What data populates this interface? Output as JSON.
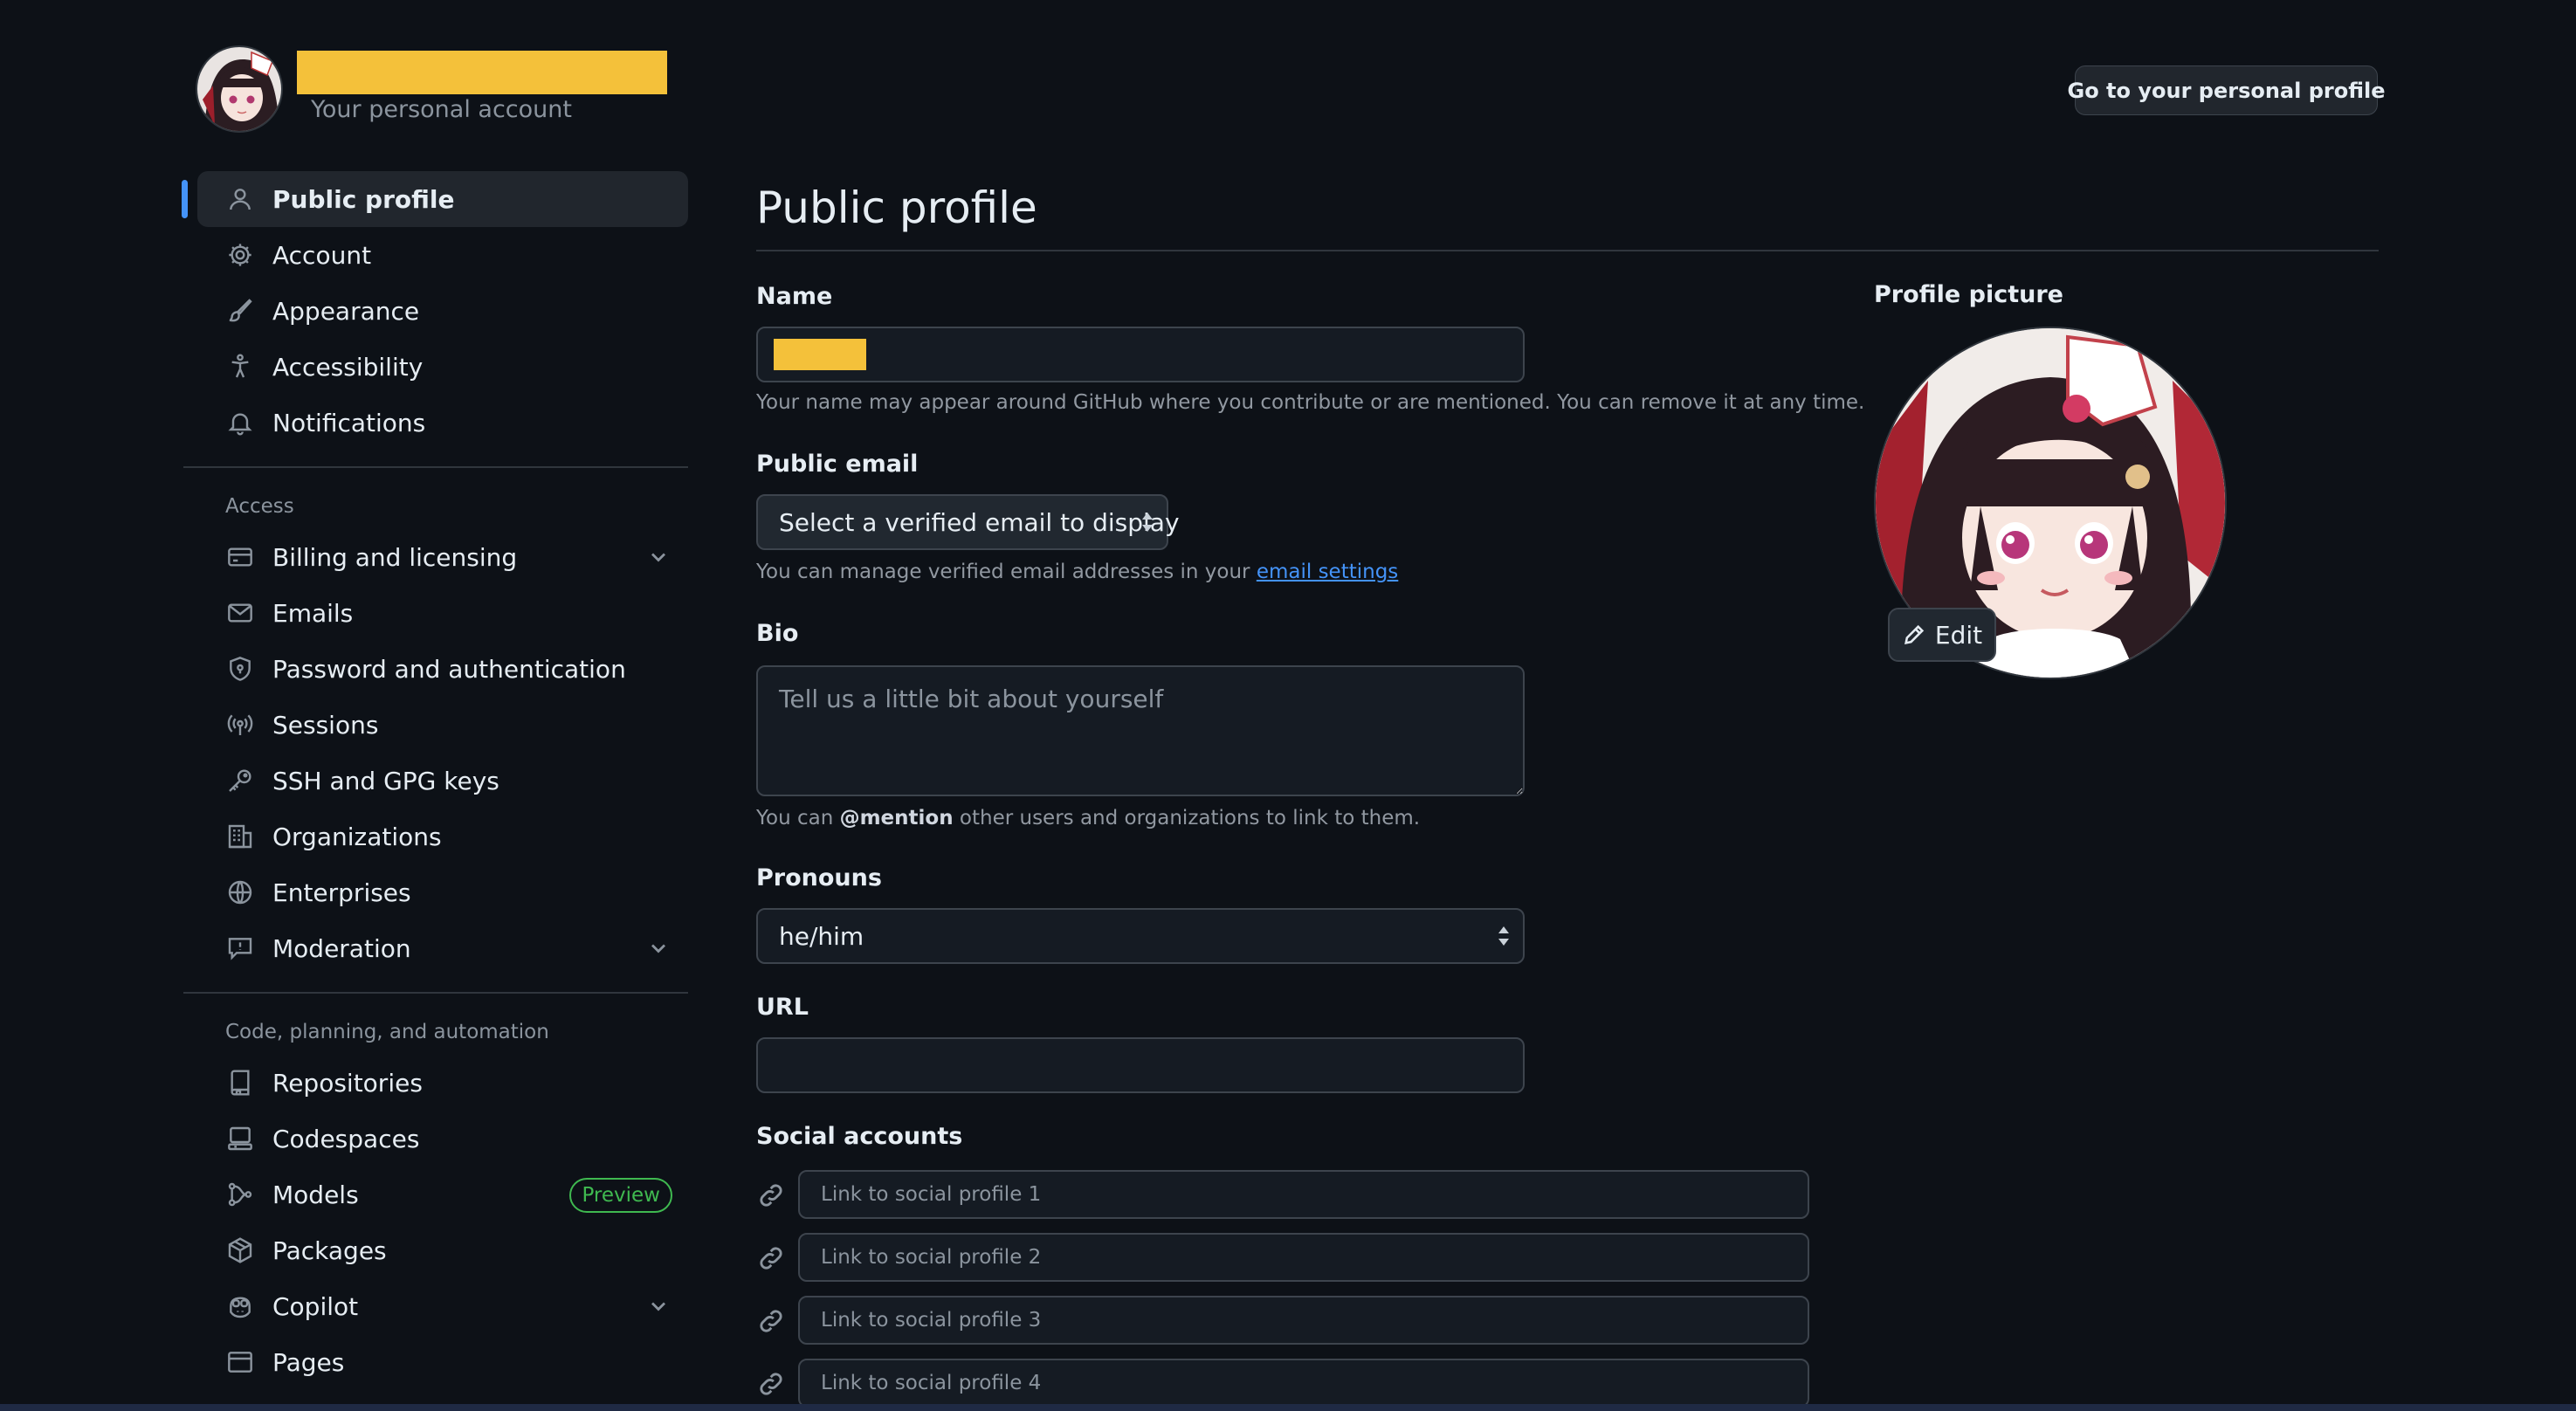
{
  "header": {
    "account_subtitle": "Your personal account",
    "go_profile_label": "Go to your personal profile"
  },
  "sidebar": {
    "top_items": [
      {
        "label": "Public profile",
        "icon": "person-icon",
        "active": true
      },
      {
        "label": "Account",
        "icon": "gear-icon"
      },
      {
        "label": "Appearance",
        "icon": "paintbrush-icon"
      },
      {
        "label": "Accessibility",
        "icon": "accessibility-icon"
      },
      {
        "label": "Notifications",
        "icon": "bell-icon"
      }
    ],
    "access_heading": "Access",
    "access_items": [
      {
        "label": "Billing and licensing",
        "icon": "credit-card-icon",
        "expandable": true
      },
      {
        "label": "Emails",
        "icon": "mail-icon"
      },
      {
        "label": "Password and authentication",
        "icon": "shield-lock-icon"
      },
      {
        "label": "Sessions",
        "icon": "broadcast-icon"
      },
      {
        "label": "SSH and GPG keys",
        "icon": "key-icon"
      },
      {
        "label": "Organizations",
        "icon": "organization-icon"
      },
      {
        "label": "Enterprises",
        "icon": "globe-icon"
      },
      {
        "label": "Moderation",
        "icon": "report-icon",
        "expandable": true
      }
    ],
    "code_heading": "Code, planning, and automation",
    "code_items": [
      {
        "label": "Repositories",
        "icon": "repo-icon"
      },
      {
        "label": "Codespaces",
        "icon": "codespaces-icon"
      },
      {
        "label": "Models",
        "icon": "models-icon",
        "badge": "Preview"
      },
      {
        "label": "Packages",
        "icon": "package-icon"
      },
      {
        "label": "Copilot",
        "icon": "copilot-icon",
        "expandable": true
      },
      {
        "label": "Pages",
        "icon": "browser-icon"
      }
    ]
  },
  "main": {
    "title": "Public profile",
    "name": {
      "label": "Name",
      "value": "",
      "help": "Your name may appear around GitHub where you contribute or are mentioned. You can remove it at any time."
    },
    "public_email": {
      "label": "Public email",
      "selected": "Select a verified email to display",
      "help_prefix": "You can manage verified email addresses in your ",
      "help_link": "email settings"
    },
    "bio": {
      "label": "Bio",
      "placeholder": "Tell us a little bit about yourself",
      "help_prefix": "You can ",
      "help_mention": "@mention",
      "help_suffix": " other users and organizations to link to them."
    },
    "pronouns": {
      "label": "Pronouns",
      "selected": "he/him"
    },
    "url": {
      "label": "URL",
      "value": ""
    },
    "social": {
      "label": "Social accounts",
      "placeholders": [
        "Link to social profile 1",
        "Link to social profile 2",
        "Link to social profile 3",
        "Link to social profile 4"
      ]
    },
    "profile_picture": {
      "label": "Profile picture",
      "edit_label": "Edit"
    }
  },
  "colors": {
    "background": "#0d1117",
    "accent": "#4493f8",
    "redaction": "#f4c13a",
    "badge_green": "#3fb950"
  }
}
